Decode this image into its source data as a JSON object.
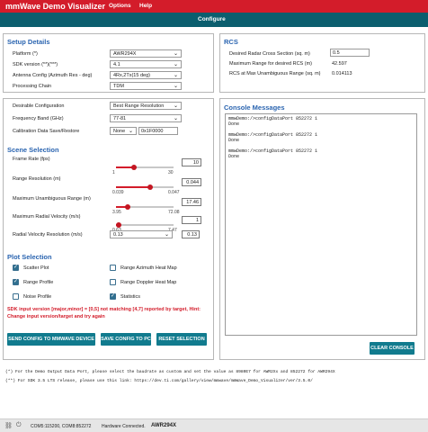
{
  "app": {
    "title": "mmWave Demo Visualizer",
    "menu": [
      "Options",
      "Help"
    ]
  },
  "tabs": {
    "active": "Configure"
  },
  "setup": {
    "heading": "Setup Details",
    "platform_label": "Platform (*)",
    "platform_value": "AWR294X",
    "sdk_label": "SDK version (**)(***)",
    "sdk_value": "4.1",
    "antenna_label": "Antenna Config (Azimuth Res - deg)",
    "antenna_value": "4Rx,2Tx(15 deg)",
    "chain_label": "Processing Chain",
    "chain_value": "TDM"
  },
  "rcs": {
    "heading": "RCS",
    "desired_label": "Desired Radar Cross Section (sq. m)",
    "desired_value": "0.5",
    "maxrange_label": "Maximum Range for desired RCS (m)",
    "maxrange_value": "42.597",
    "unamb_label": "RCS at Max Unambiguous Range (sq. m)",
    "unamb_value": "0.014113"
  },
  "config": {
    "desirable_label": "Desirable Configuration",
    "desirable_value": "Best Range Resolution",
    "band_label": "Frequency Band (GHz)",
    "band_value": "77-81",
    "calib_label": "Calibration Data Save/Restore",
    "calib_value": "None",
    "calib_addr": "0x1F0000"
  },
  "scene": {
    "heading": "Scene Selection",
    "sliders": [
      {
        "label": "Frame Rate (fps)",
        "min": "1",
        "max": "30",
        "value": "10",
        "frac": 0.31
      },
      {
        "label": "Range Resolution (m)",
        "min": "0.039",
        "max": "0.047",
        "value": "0.044",
        "frac": 0.6
      },
      {
        "label": "Maximum Unambiguous Range (m)",
        "min": "3.95",
        "max": "72.08",
        "value": "17.46",
        "frac": 0.2
      },
      {
        "label": "Maximum Radial Velocity (m/s)",
        "min": "0.63",
        "max": "7.47",
        "value": "1",
        "frac": 0.05
      }
    ],
    "vres_label": "Radial Velocity Resolution (m/s)",
    "vres_value": "0.13",
    "vres_box": "0.13"
  },
  "plots": {
    "heading": "Plot Selection",
    "items": [
      {
        "label": "Scatter Plot",
        "checked": true
      },
      {
        "label": "Range Azimuth Heat Map",
        "checked": false
      },
      {
        "label": "Range Profile",
        "checked": true
      },
      {
        "label": "Range Doppler Heat Map",
        "checked": false
      },
      {
        "label": "Noise Profile",
        "checked": false
      },
      {
        "label": "Statistics",
        "checked": true
      }
    ]
  },
  "error": {
    "line1": "SDK input version [major,minor] = [0,5] not matching [4,7] reported by target, Hint:",
    "line2": "Change input version/target and try again"
  },
  "buttons": {
    "send": "SEND CONFIG TO MMWAVE DEVICE",
    "save": "SAVE CONFIG TO PC",
    "reset": "RESET SELECTION",
    "clear": "CLEAR CONSOLE"
  },
  "console": {
    "heading": "Console Messages",
    "text": "mmwDemo:/>configDataPort 852272 1\nDone\n\nmmwDemo:/>configDataPort 852272 1\nDone\n\nmmwDemo:/>configDataPort 852272 1\nDone"
  },
  "notes": {
    "line1": "(*)  For the Demo Output Data Port, please select the baudrate as custom and set the value as 8980E7 for AWR2Xx and 852272 for AWR294X",
    "line2": "(**)  For SDK 3.5 LTS release, please use this link: https://dev.ti.com/gallery/view/mmwave/mmWave_Demo_Visualizer/ver/3.5.0/"
  },
  "status": {
    "ports": "COM5:115200, COM8:852272",
    "hw": "Hardware Connected.",
    "device": "AWR294X"
  }
}
